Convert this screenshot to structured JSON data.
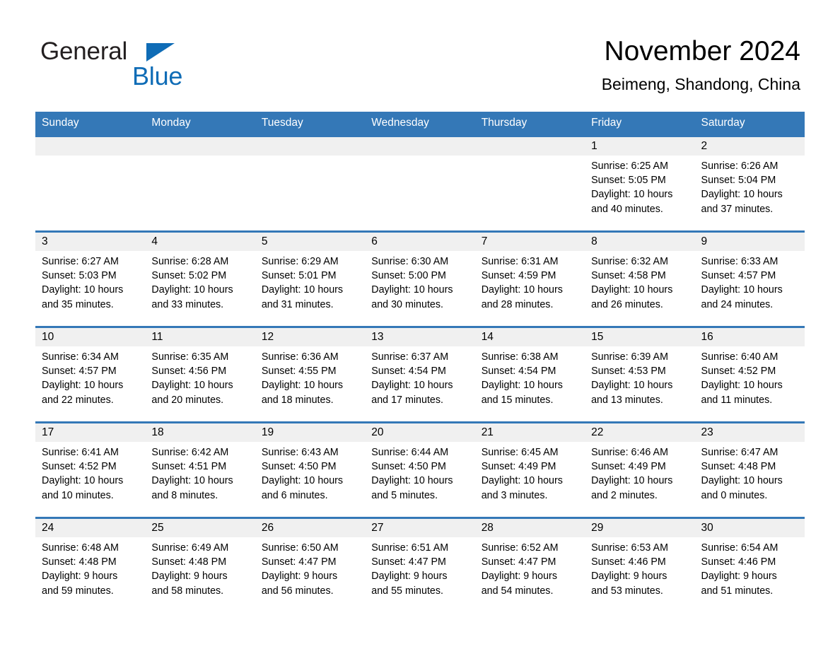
{
  "brand": {
    "name_part1": "General",
    "name_part2": "Blue",
    "logo_icon": "blue-triangle-icon",
    "color_primary": "#0f6cb6",
    "color_text": "#231f20"
  },
  "header": {
    "title": "November 2024",
    "subtitle": "Beimeng, Shandong, China"
  },
  "theme": {
    "header_bg": "#3478b7",
    "daynum_bg": "#f0f0f0",
    "cell_bg": "#ffffff",
    "text": "#000000"
  },
  "weekday_headers": [
    "Sunday",
    "Monday",
    "Tuesday",
    "Wednesday",
    "Thursday",
    "Friday",
    "Saturday"
  ],
  "weeks": [
    [
      {
        "day": "",
        "sunrise": "",
        "sunset": "",
        "daylight_line1": "",
        "daylight_line2": ""
      },
      {
        "day": "",
        "sunrise": "",
        "sunset": "",
        "daylight_line1": "",
        "daylight_line2": ""
      },
      {
        "day": "",
        "sunrise": "",
        "sunset": "",
        "daylight_line1": "",
        "daylight_line2": ""
      },
      {
        "day": "",
        "sunrise": "",
        "sunset": "",
        "daylight_line1": "",
        "daylight_line2": ""
      },
      {
        "day": "",
        "sunrise": "",
        "sunset": "",
        "daylight_line1": "",
        "daylight_line2": ""
      },
      {
        "day": "1",
        "sunrise": "Sunrise: 6:25 AM",
        "sunset": "Sunset: 5:05 PM",
        "daylight_line1": "Daylight: 10 hours",
        "daylight_line2": "and 40 minutes."
      },
      {
        "day": "2",
        "sunrise": "Sunrise: 6:26 AM",
        "sunset": "Sunset: 5:04 PM",
        "daylight_line1": "Daylight: 10 hours",
        "daylight_line2": "and 37 minutes."
      }
    ],
    [
      {
        "day": "3",
        "sunrise": "Sunrise: 6:27 AM",
        "sunset": "Sunset: 5:03 PM",
        "daylight_line1": "Daylight: 10 hours",
        "daylight_line2": "and 35 minutes."
      },
      {
        "day": "4",
        "sunrise": "Sunrise: 6:28 AM",
        "sunset": "Sunset: 5:02 PM",
        "daylight_line1": "Daylight: 10 hours",
        "daylight_line2": "and 33 minutes."
      },
      {
        "day": "5",
        "sunrise": "Sunrise: 6:29 AM",
        "sunset": "Sunset: 5:01 PM",
        "daylight_line1": "Daylight: 10 hours",
        "daylight_line2": "and 31 minutes."
      },
      {
        "day": "6",
        "sunrise": "Sunrise: 6:30 AM",
        "sunset": "Sunset: 5:00 PM",
        "daylight_line1": "Daylight: 10 hours",
        "daylight_line2": "and 30 minutes."
      },
      {
        "day": "7",
        "sunrise": "Sunrise: 6:31 AM",
        "sunset": "Sunset: 4:59 PM",
        "daylight_line1": "Daylight: 10 hours",
        "daylight_line2": "and 28 minutes."
      },
      {
        "day": "8",
        "sunrise": "Sunrise: 6:32 AM",
        "sunset": "Sunset: 4:58 PM",
        "daylight_line1": "Daylight: 10 hours",
        "daylight_line2": "and 26 minutes."
      },
      {
        "day": "9",
        "sunrise": "Sunrise: 6:33 AM",
        "sunset": "Sunset: 4:57 PM",
        "daylight_line1": "Daylight: 10 hours",
        "daylight_line2": "and 24 minutes."
      }
    ],
    [
      {
        "day": "10",
        "sunrise": "Sunrise: 6:34 AM",
        "sunset": "Sunset: 4:57 PM",
        "daylight_line1": "Daylight: 10 hours",
        "daylight_line2": "and 22 minutes."
      },
      {
        "day": "11",
        "sunrise": "Sunrise: 6:35 AM",
        "sunset": "Sunset: 4:56 PM",
        "daylight_line1": "Daylight: 10 hours",
        "daylight_line2": "and 20 minutes."
      },
      {
        "day": "12",
        "sunrise": "Sunrise: 6:36 AM",
        "sunset": "Sunset: 4:55 PM",
        "daylight_line1": "Daylight: 10 hours",
        "daylight_line2": "and 18 minutes."
      },
      {
        "day": "13",
        "sunrise": "Sunrise: 6:37 AM",
        "sunset": "Sunset: 4:54 PM",
        "daylight_line1": "Daylight: 10 hours",
        "daylight_line2": "and 17 minutes."
      },
      {
        "day": "14",
        "sunrise": "Sunrise: 6:38 AM",
        "sunset": "Sunset: 4:54 PM",
        "daylight_line1": "Daylight: 10 hours",
        "daylight_line2": "and 15 minutes."
      },
      {
        "day": "15",
        "sunrise": "Sunrise: 6:39 AM",
        "sunset": "Sunset: 4:53 PM",
        "daylight_line1": "Daylight: 10 hours",
        "daylight_line2": "and 13 minutes."
      },
      {
        "day": "16",
        "sunrise": "Sunrise: 6:40 AM",
        "sunset": "Sunset: 4:52 PM",
        "daylight_line1": "Daylight: 10 hours",
        "daylight_line2": "and 11 minutes."
      }
    ],
    [
      {
        "day": "17",
        "sunrise": "Sunrise: 6:41 AM",
        "sunset": "Sunset: 4:52 PM",
        "daylight_line1": "Daylight: 10 hours",
        "daylight_line2": "and 10 minutes."
      },
      {
        "day": "18",
        "sunrise": "Sunrise: 6:42 AM",
        "sunset": "Sunset: 4:51 PM",
        "daylight_line1": "Daylight: 10 hours",
        "daylight_line2": "and 8 minutes."
      },
      {
        "day": "19",
        "sunrise": "Sunrise: 6:43 AM",
        "sunset": "Sunset: 4:50 PM",
        "daylight_line1": "Daylight: 10 hours",
        "daylight_line2": "and 6 minutes."
      },
      {
        "day": "20",
        "sunrise": "Sunrise: 6:44 AM",
        "sunset": "Sunset: 4:50 PM",
        "daylight_line1": "Daylight: 10 hours",
        "daylight_line2": "and 5 minutes."
      },
      {
        "day": "21",
        "sunrise": "Sunrise: 6:45 AM",
        "sunset": "Sunset: 4:49 PM",
        "daylight_line1": "Daylight: 10 hours",
        "daylight_line2": "and 3 minutes."
      },
      {
        "day": "22",
        "sunrise": "Sunrise: 6:46 AM",
        "sunset": "Sunset: 4:49 PM",
        "daylight_line1": "Daylight: 10 hours",
        "daylight_line2": "and 2 minutes."
      },
      {
        "day": "23",
        "sunrise": "Sunrise: 6:47 AM",
        "sunset": "Sunset: 4:48 PM",
        "daylight_line1": "Daylight: 10 hours",
        "daylight_line2": "and 0 minutes."
      }
    ],
    [
      {
        "day": "24",
        "sunrise": "Sunrise: 6:48 AM",
        "sunset": "Sunset: 4:48 PM",
        "daylight_line1": "Daylight: 9 hours",
        "daylight_line2": "and 59 minutes."
      },
      {
        "day": "25",
        "sunrise": "Sunrise: 6:49 AM",
        "sunset": "Sunset: 4:48 PM",
        "daylight_line1": "Daylight: 9 hours",
        "daylight_line2": "and 58 minutes."
      },
      {
        "day": "26",
        "sunrise": "Sunrise: 6:50 AM",
        "sunset": "Sunset: 4:47 PM",
        "daylight_line1": "Daylight: 9 hours",
        "daylight_line2": "and 56 minutes."
      },
      {
        "day": "27",
        "sunrise": "Sunrise: 6:51 AM",
        "sunset": "Sunset: 4:47 PM",
        "daylight_line1": "Daylight: 9 hours",
        "daylight_line2": "and 55 minutes."
      },
      {
        "day": "28",
        "sunrise": "Sunrise: 6:52 AM",
        "sunset": "Sunset: 4:47 PM",
        "daylight_line1": "Daylight: 9 hours",
        "daylight_line2": "and 54 minutes."
      },
      {
        "day": "29",
        "sunrise": "Sunrise: 6:53 AM",
        "sunset": "Sunset: 4:46 PM",
        "daylight_line1": "Daylight: 9 hours",
        "daylight_line2": "and 53 minutes."
      },
      {
        "day": "30",
        "sunrise": "Sunrise: 6:54 AM",
        "sunset": "Sunset: 4:46 PM",
        "daylight_line1": "Daylight: 9 hours",
        "daylight_line2": "and 51 minutes."
      }
    ]
  ]
}
